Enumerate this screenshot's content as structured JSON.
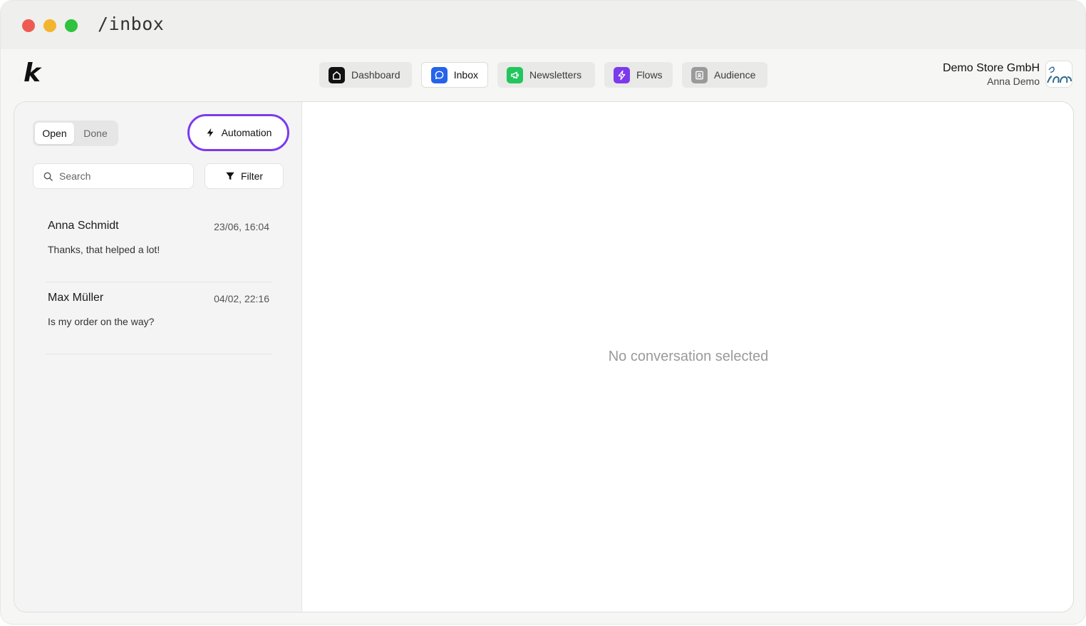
{
  "window": {
    "url": "/inbox"
  },
  "brand": {
    "logo_text": "k"
  },
  "nav": [
    {
      "label": "Dashboard",
      "icon": "home-icon",
      "color": "#111111"
    },
    {
      "label": "Inbox",
      "icon": "chat-bubble-icon",
      "color": "#2563eb"
    },
    {
      "label": "Newsletters",
      "icon": "megaphone-icon",
      "color": "#22c55e"
    },
    {
      "label": "Flows",
      "icon": "lightning-icon",
      "color": "#7c3aed"
    },
    {
      "label": "Audience",
      "icon": "contact-book-icon",
      "color": "#9a9a9a"
    }
  ],
  "user": {
    "company": "Demo Store GmbH",
    "name": "Anna Demo"
  },
  "sidebar": {
    "tabs": {
      "open": "Open",
      "done": "Done"
    },
    "automation_label": "Automation",
    "search_placeholder": "Search",
    "filter_label": "Filter",
    "conversations": [
      {
        "name": "Anna Schmidt",
        "date": "23/06, 16:04",
        "message": "Thanks, that helped a lot!"
      },
      {
        "name": "Max Müller",
        "date": "04/02, 22:16",
        "message": "Is my order on the way?"
      }
    ]
  },
  "main": {
    "empty_text": "No conversation selected"
  },
  "colors": {
    "accent": "#7c3aed",
    "inbox_blue": "#2563eb",
    "newsletter_green": "#22c55e"
  }
}
